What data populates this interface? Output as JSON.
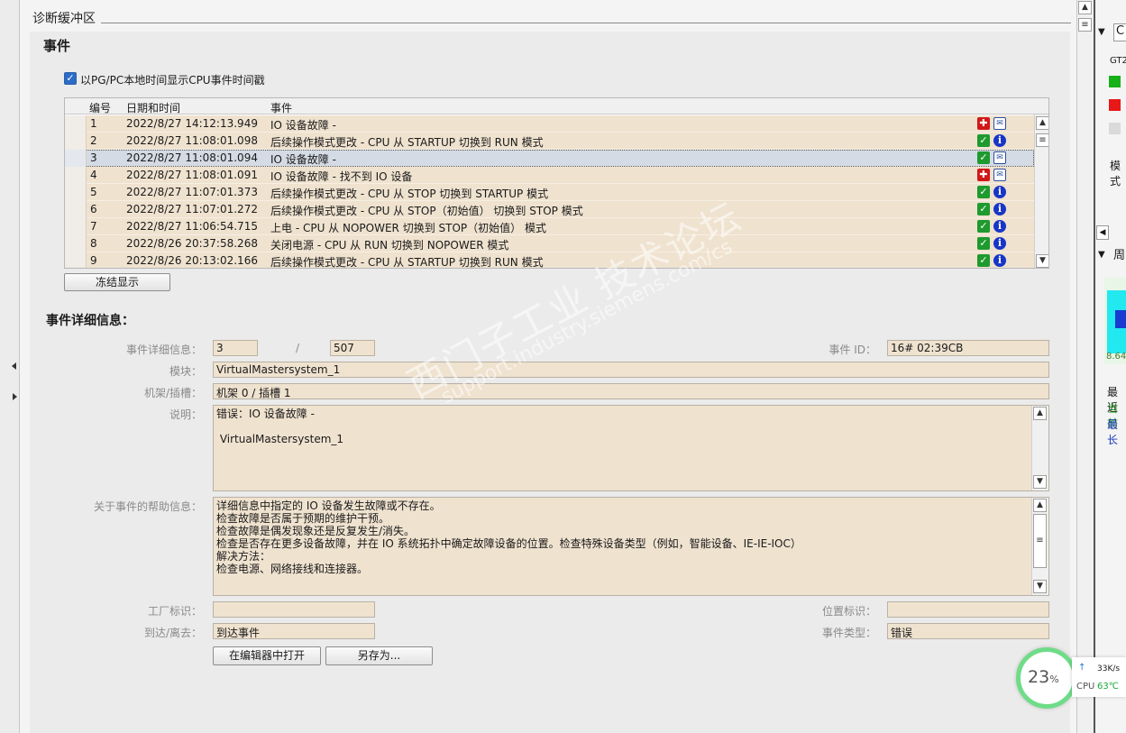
{
  "section_title": "诊断缓冲区",
  "events_title": "事件",
  "checkbox": {
    "label": "以PG/PC本地时间显示CPU事件时间戳",
    "checked": true
  },
  "table": {
    "headers": {
      "num": "编号",
      "datetime": "日期和时间",
      "event": "事件"
    },
    "rows": [
      {
        "num": "1",
        "datetime": "2022/8/27 14:12:13.949",
        "event": "IO 设备故障 -",
        "icon1": "error-icon",
        "icon2": "message-icon"
      },
      {
        "num": "2",
        "datetime": "2022/8/27 11:08:01.098",
        "event": "后续操作模式更改  - CPU 从 STARTUP 切换到 RUN 模式",
        "icon1": "ok-icon",
        "icon2": "info-icon"
      },
      {
        "num": "3",
        "datetime": "2022/8/27 11:08:01.094",
        "event": "IO 设备故障 -",
        "icon1": "ok-icon",
        "icon2": "message-icon"
      },
      {
        "num": "4",
        "datetime": "2022/8/27 11:08:01.091",
        "event": "IO 设备故障 - 找不到 IO 设备",
        "icon1": "error-icon",
        "icon2": "message-icon"
      },
      {
        "num": "5",
        "datetime": "2022/8/27 11:07:01.373",
        "event": "后续操作模式更改  - CPU 从 STOP 切换到 STARTUP 模式",
        "icon1": "ok-icon",
        "icon2": "info-icon"
      },
      {
        "num": "6",
        "datetime": "2022/8/27 11:07:01.272",
        "event": "后续操作模式更改  - CPU 从 STOP（初始值） 切换到 STOP 模式",
        "icon1": "ok-icon",
        "icon2": "info-icon"
      },
      {
        "num": "7",
        "datetime": "2022/8/27 11:06:54.715",
        "event": "上电 - CPU 从 NOPOWER 切换到 STOP（初始值） 模式",
        "icon1": "ok-icon",
        "icon2": "info-icon"
      },
      {
        "num": "8",
        "datetime": "2022/8/26 20:37:58.268",
        "event": "关闭电源 - CPU 从 RUN 切换到 NOPOWER 模式",
        "icon1": "ok-icon",
        "icon2": "info-icon"
      },
      {
        "num": "9",
        "datetime": "2022/8/26 20:13:02.166",
        "event": "后续操作模式更改  - CPU 从 STARTUP 切换到 RUN 模式",
        "icon1": "ok-icon",
        "icon2": "info-icon"
      }
    ],
    "selected_row": 3
  },
  "freeze_button": "冻结显示",
  "detail": {
    "title": "事件详细信息：",
    "event_detail_label": "事件详细信息：",
    "event_index": "3",
    "slash": "/",
    "event_total": "507",
    "event_id_label": "事件 ID：",
    "event_id": "16# 02:39CB",
    "module_label": "模块：",
    "module": "VirtualMastersystem_1",
    "rack_slot_label": "机架/插槽：",
    "rack_slot": "机架 0 / 插槽 1",
    "description_label": "说明：",
    "description_lines": [
      "错误：IO 设备故障 -",
      "",
      " VirtualMastersystem_1"
    ],
    "help_label": "关于事件的帮助信息：",
    "help_lines": [
      "详细信息中指定的 IO 设备发生故障或不存在。",
      "检查故障是否属于预期的维护干预。",
      "检查故障是偶发现象还是反复发生/消失。",
      "检查是否存在更多设备故障，并在 IO 系统拓扑中确定故障设备的位置。检查特殊设备类型（例如，智能设备、IE-IE-IOC）",
      "解决方法：",
      "检查电源、网络接线和连接器。"
    ],
    "plant_label": "工厂标识：",
    "plant_value": "",
    "location_label": "位置标识：",
    "location_value": "",
    "arrive_label": "到达/离去：",
    "arrive_value": "到达事件",
    "event_type_label": "事件类型：",
    "event_type_value": "错误",
    "open_editor_button": "在编辑器中打开",
    "save_as_button": "另存为..."
  },
  "watermark": {
    "line1": "西门子工业  技术论坛",
    "line2": "support.industry.siemens.com/cs"
  },
  "right_pane": {
    "tab_c": "C",
    "gt_label": "GT2",
    "mode_label": "模式",
    "tab_week": "周",
    "value": "8.64",
    "recent": "最近",
    "current": "当前",
    "longest": "最长"
  },
  "system_monitor": {
    "percent": "23",
    "percent_sign": "%",
    "net_speed": "33K/s",
    "cpu_label": "CPU",
    "cpu_temp": "63℃"
  },
  "colors": {
    "row_bg": "#efe2cf",
    "selected_row_bg": "#d4dbe4",
    "ok": "#1e9a2e",
    "error": "#d01818",
    "info": "#1736c8"
  }
}
